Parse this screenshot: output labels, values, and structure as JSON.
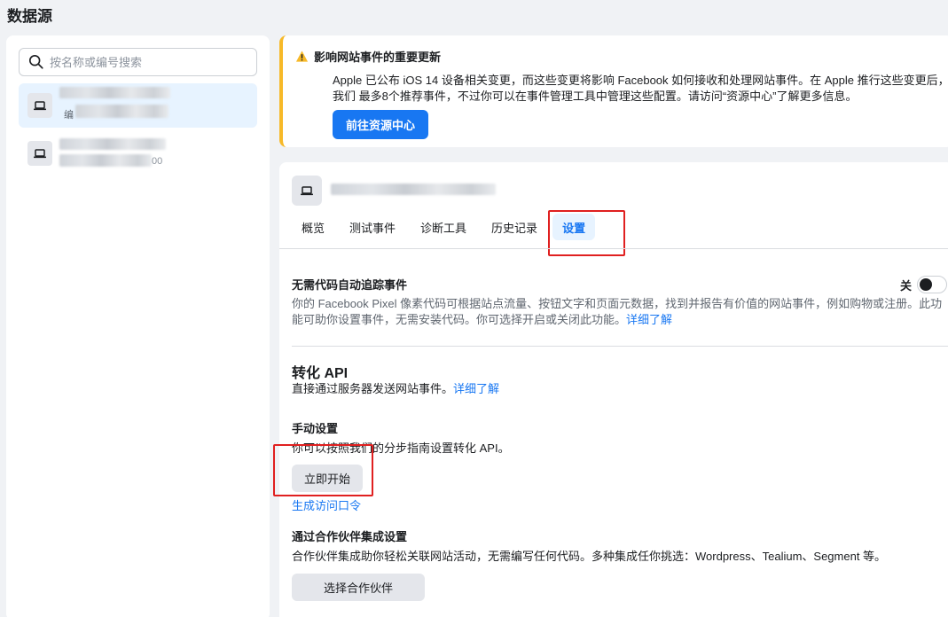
{
  "page": {
    "title": "数据源"
  },
  "sidebar": {
    "search_placeholder": "按名称或编号搜索",
    "items": [
      {
        "selected": true,
        "id_prefix": "编"
      },
      {
        "selected": false,
        "id_suffix": "00"
      }
    ]
  },
  "notice": {
    "title": "影响网站事件的重要更新",
    "body": "Apple 已公布 iOS 14 设备相关变更，而这些变更将影响 Facebook 如何接收和处理网站事件。在 Apple 推行这些变更后，我们 最多8个推荐事件，不过你可以在事件管理工具中管理这些配置。请访问“资源中心”了解更多信息。",
    "button_label": "前往资源中心",
    "accent_color": "#f7b928"
  },
  "tabs": [
    {
      "label": "概览",
      "active": false
    },
    {
      "label": "测试事件",
      "active": false
    },
    {
      "label": "诊断工具",
      "active": false
    },
    {
      "label": "历史记录",
      "active": false
    },
    {
      "label": "设置",
      "active": true
    }
  ],
  "auto_tracking": {
    "title": "无需代码自动追踪事件",
    "toggle_label": "关",
    "toggle_on": false,
    "description": "你的 Facebook Pixel 像素代码可根据站点流量、按钮文字和页面元数据，找到并报告有价值的网站事件，例如购物或注册。此功能可助你设置事件，无需安装代码。你可选择开启或关闭此功能。",
    "learn_more": "详细了解"
  },
  "conversion_api": {
    "title": "转化 API",
    "description": "直接通过服务器发送网站事件。",
    "learn_more": "详细了解",
    "manual": {
      "title": "手动设置",
      "description": "你可以按照我们的分步指南设置转化 API。",
      "button_label": "立即开始",
      "token_link": "生成访问口令"
    },
    "partner": {
      "title": "通过合作伙伴集成设置",
      "description": "合作伙伴集成助你轻松关联网站活动，无需编写任何代码。多种集成任你挑选：Wordpress、Tealium、Segment 等。",
      "button_label": "选择合作伙伴"
    }
  },
  "colors": {
    "primary": "#1877f2",
    "highlight": "#e02020",
    "selected_bg": "#e7f3ff"
  }
}
